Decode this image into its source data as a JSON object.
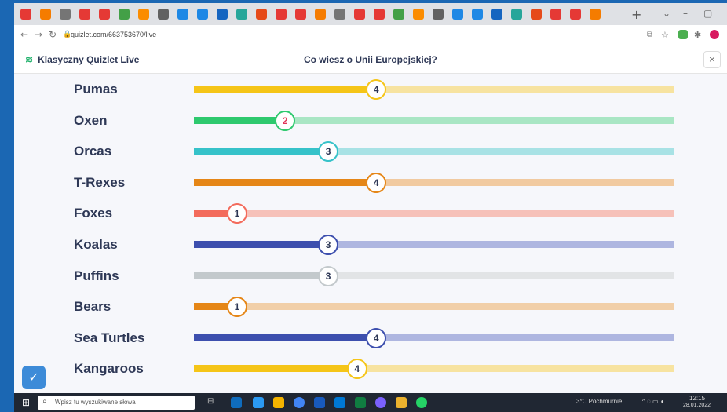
{
  "browser": {
    "url": "quizlet.com/663753670/live",
    "tab_colors": [
      "#e53935",
      "#f57c00",
      "#757575",
      "#e53935",
      "#e53935",
      "#43a047",
      "#fb8c00",
      "#616161",
      "#1e88e5",
      "#1e88e5",
      "#1565c0",
      "#26a69a",
      "#e64a19",
      "#e53935"
    ]
  },
  "app": {
    "brand_label": "Klasyczny Quizlet Live",
    "brand_icon": "quizlet-live-logo-icon",
    "quiz_title": "Co wiesz o Unii Europejskiej?",
    "close_label": "×"
  },
  "teams": [
    {
      "name": "Pumas",
      "score": "4",
      "level": 0.38,
      "color": "#f5c518",
      "light": "#f7e3a0"
    },
    {
      "name": "Oxen",
      "score": "2",
      "level": 0.19,
      "color": "#2ec96e",
      "light": "#a9e6c4"
    },
    {
      "name": "Orcas",
      "score": "3",
      "level": 0.28,
      "color": "#36c2c9",
      "light": "#a8e2e5"
    },
    {
      "name": "T-Rexes",
      "score": "4",
      "level": 0.38,
      "color": "#e58617",
      "light": "#f1caa0"
    },
    {
      "name": "Foxes",
      "score": "1",
      "level": 0.09,
      "color": "#f36b5c",
      "light": "#f6c1b9"
    },
    {
      "name": "Koalas",
      "score": "3",
      "level": 0.28,
      "color": "#3d4fae",
      "light": "#aeb6e0"
    },
    {
      "name": "Puffins",
      "score": "3",
      "level": 0.28,
      "color": "#c3c9cc",
      "light": "#e2e4e6"
    },
    {
      "name": "Bears",
      "score": "1",
      "level": 0.09,
      "color": "#e58617",
      "light": "#f1cfa8"
    },
    {
      "name": "Sea Turtles",
      "score": "4",
      "level": 0.38,
      "color": "#3d4fae",
      "light": "#aeb6e0"
    },
    {
      "name": "Kangaroos",
      "score": "4",
      "level": 0.34,
      "color": "#f5c518",
      "light": "#f7e3a0"
    }
  ],
  "taskbar": {
    "search_placeholder": "Wpisz tu wyszukiwane słowa",
    "weather": "3°C Pochmurnie",
    "time": "12:15",
    "date": "28.01.2022"
  }
}
